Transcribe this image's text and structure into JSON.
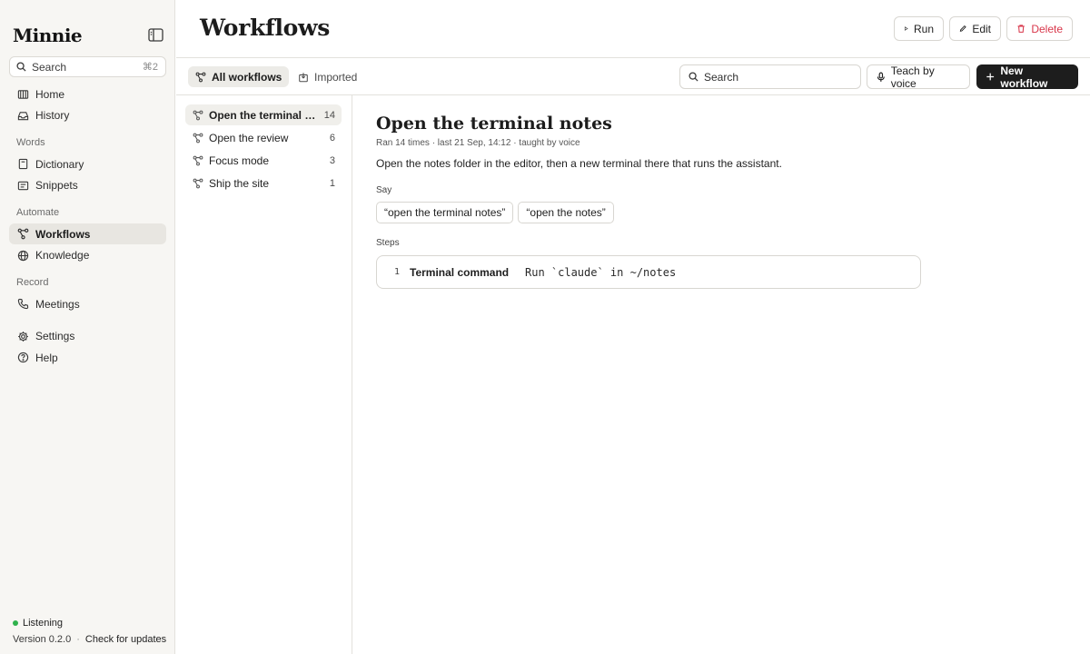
{
  "app": {
    "logo": "Minnie",
    "search_placeholder": "Search",
    "search_shortcut": "⌘2"
  },
  "sidebar": {
    "items_top": [
      {
        "label": "Home",
        "icon": "home-icon"
      },
      {
        "label": "History",
        "icon": "inbox-icon"
      }
    ],
    "sections": [
      {
        "title": "Words",
        "items": [
          {
            "label": "Dictionary",
            "icon": "book-icon"
          },
          {
            "label": "Snippets",
            "icon": "snippets-icon"
          }
        ]
      },
      {
        "title": "Automate",
        "items": [
          {
            "label": "Workflows",
            "icon": "workflow-icon",
            "active": true
          },
          {
            "label": "Knowledge",
            "icon": "globe-icon"
          }
        ]
      },
      {
        "title": "Record",
        "items": [
          {
            "label": "Meetings",
            "icon": "phone-icon"
          }
        ]
      }
    ],
    "items_bottom": [
      {
        "label": "Settings",
        "icon": "gear-icon"
      },
      {
        "label": "Help",
        "icon": "help-icon"
      }
    ],
    "status": "Listening",
    "status_color": "#2fb24c",
    "version": "Version 0.2.0",
    "separator": "·",
    "check_updates": "Check for updates"
  },
  "header": {
    "title": "Workflows",
    "run_label": "Run",
    "edit_label": "Edit",
    "delete_label": "Delete",
    "delete_color": "#d8364a"
  },
  "toolbar": {
    "tab_all": "All workflows",
    "tab_imported": "Imported",
    "search_placeholder": "Search",
    "teach_label": "Teach by voice",
    "new_label": "New workflow"
  },
  "workflows": [
    {
      "name": "Open the terminal notes",
      "count": "14",
      "active": true
    },
    {
      "name": "Open the review",
      "count": "6"
    },
    {
      "name": "Focus mode",
      "count": "3"
    },
    {
      "name": "Ship the site",
      "count": "1"
    }
  ],
  "detail": {
    "title": "Open the terminal notes",
    "meta": "Ran 14 times · last 21 Sep, 14:12 · taught by voice",
    "description": "Open the notes folder in the editor, then a new terminal there that runs the assistant.",
    "say_label": "Say",
    "phrases": [
      "“open the terminal notes”",
      "“open the notes”"
    ],
    "steps_label": "Steps",
    "steps": [
      {
        "num": "1",
        "type": "Terminal command",
        "command": "Run `claude` in ~/notes"
      }
    ]
  }
}
